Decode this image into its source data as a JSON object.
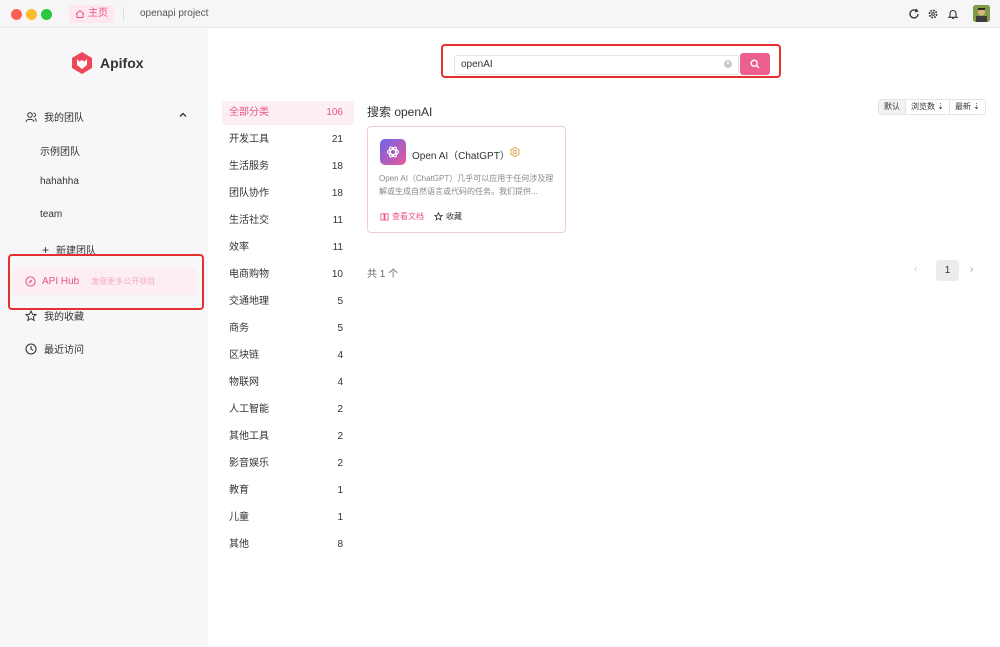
{
  "titlebar": {
    "home_tab": "主页",
    "project_tab": "openapi project",
    "icons": [
      "refresh-icon",
      "gear-icon",
      "bell-icon",
      "avatar"
    ]
  },
  "sidebar": {
    "logo_text": "Apifox",
    "my_team": "我的团队",
    "teams": [
      "示例团队",
      "hahahha",
      "team"
    ],
    "new_team": "新建团队",
    "api_hub": "API Hub",
    "api_hub_desc": "发现更多公开项目",
    "favorites": "我的收藏",
    "recent": "最近访问"
  },
  "search": {
    "value": "openAI"
  },
  "categories": [
    {
      "label": "全部分类",
      "count": "106",
      "active": true
    },
    {
      "label": "开发工具",
      "count": "21"
    },
    {
      "label": "生活服务",
      "count": "18"
    },
    {
      "label": "团队协作",
      "count": "18"
    },
    {
      "label": "生活社交",
      "count": "11"
    },
    {
      "label": "效率",
      "count": "11"
    },
    {
      "label": "电商购物",
      "count": "10"
    },
    {
      "label": "交通地理",
      "count": "5"
    },
    {
      "label": "商务",
      "count": "5"
    },
    {
      "label": "区块链",
      "count": "4"
    },
    {
      "label": "物联网",
      "count": "4"
    },
    {
      "label": "人工智能",
      "count": "2"
    },
    {
      "label": "其他工具",
      "count": "2"
    },
    {
      "label": "影音娱乐",
      "count": "2"
    },
    {
      "label": "教育",
      "count": "1"
    },
    {
      "label": "儿童",
      "count": "1"
    },
    {
      "label": "其他",
      "count": "8"
    }
  ],
  "results": {
    "title": "搜索 openAI",
    "sort_options": [
      "默认",
      "浏览数 ⇣",
      "最新 ⇣"
    ],
    "card": {
      "title": "Open AI（ChatGPT）",
      "description": "Open AI（ChatGPT）几乎可以应用于任何涉及理解或生成自然语言或代码的任务。我们提供...",
      "doc_link": "查看文档",
      "favorite": "收藏"
    },
    "total": "共 1 个",
    "page": "1"
  },
  "colors": {
    "accent": "#e8548a",
    "search_button": "#ec5f8e",
    "highlight_box": "#e6302e",
    "logo": "#f0465a"
  }
}
